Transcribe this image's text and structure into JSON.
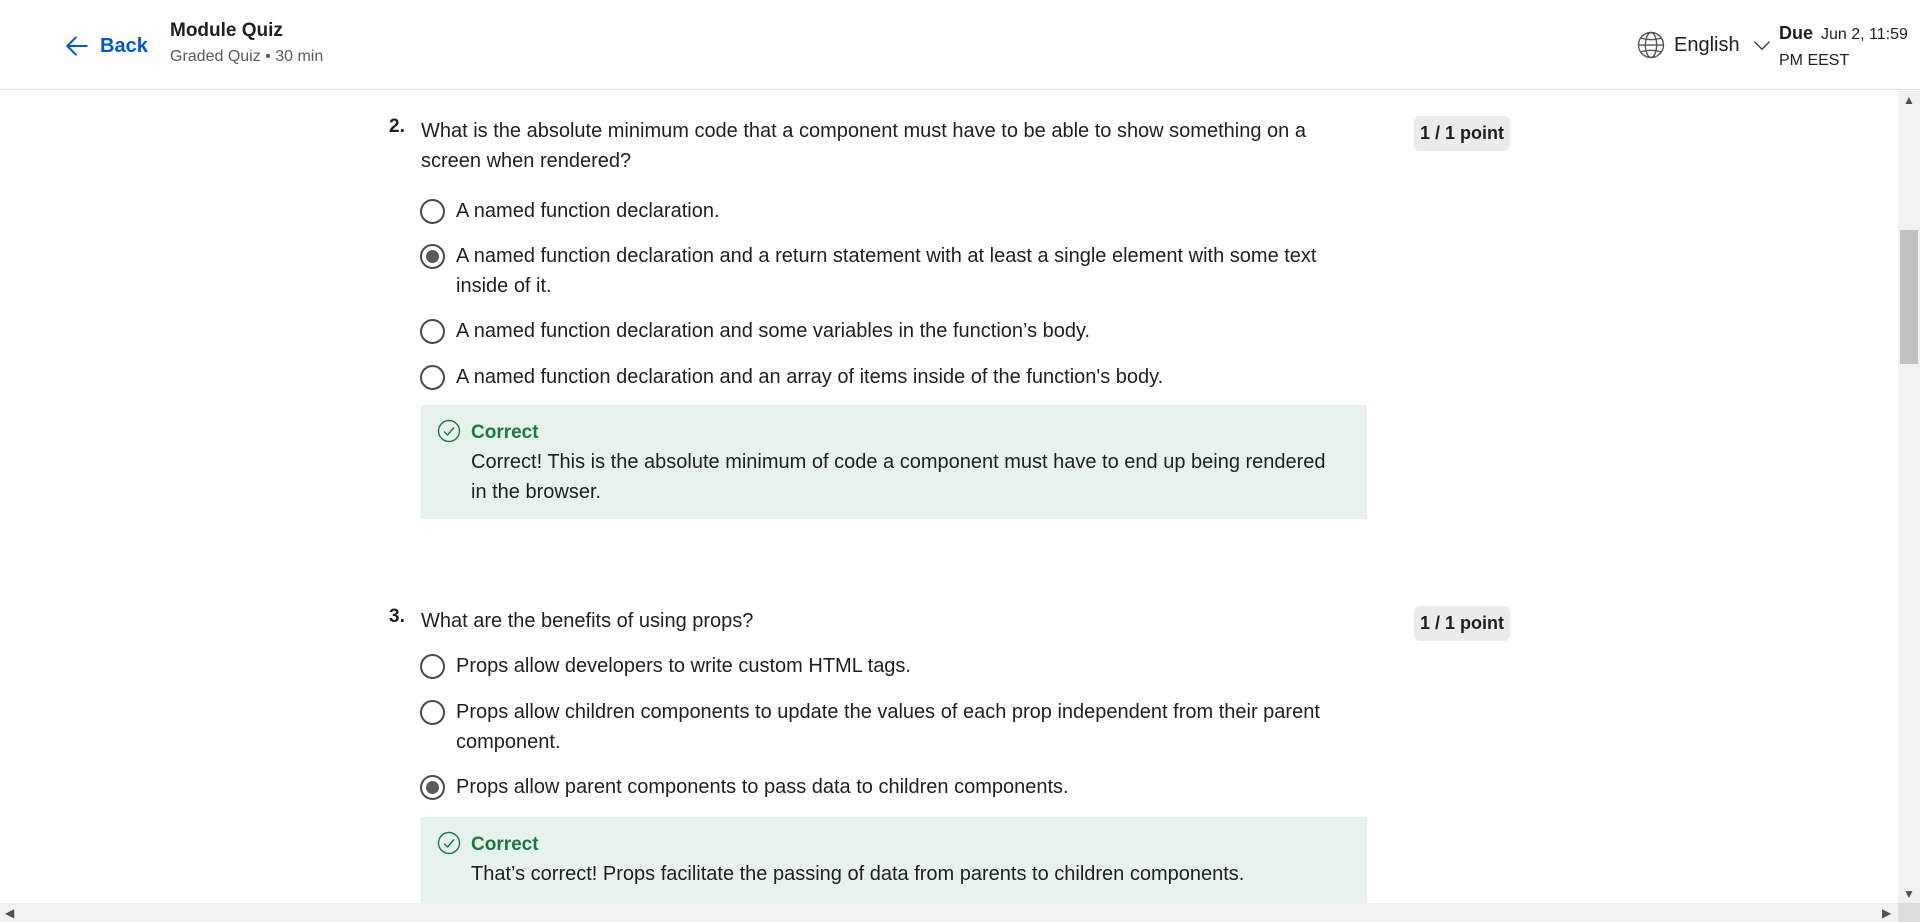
{
  "header": {
    "back_label": "Back",
    "title": "Module Quiz",
    "subtitle": "Graded Quiz • 30 min",
    "language": "English",
    "due_label": "Due",
    "due_date": "Jun 2, 11:59 PM EEST"
  },
  "questions": [
    {
      "number": "2.",
      "text": "What is the absolute minimum code that a component must have to be able to show something on a screen when rendered?",
      "points": "1 / 1 point",
      "options": [
        {
          "label": "A named function declaration.",
          "selected": false
        },
        {
          "label": "A named function declaration and a return statement with at least a single element with some text inside of it.",
          "selected": true
        },
        {
          "label": "A named function declaration and some variables in the function’s body.",
          "selected": false
        },
        {
          "label": "A named function declaration and an array of items inside of the function's body.",
          "selected": false
        }
      ],
      "feedback": {
        "title": "Correct",
        "text": "Correct! This is the absolute minimum of code a component must have to end up being rendered in the browser."
      }
    },
    {
      "number": "3.",
      "text": "What are the benefits of using props?",
      "points": "1 / 1 point",
      "options": [
        {
          "label": "Props allow developers to write custom HTML tags.",
          "selected": false
        },
        {
          "label": "Props allow children components to update the values of each prop independent from their parent component.",
          "selected": false
        },
        {
          "label": "Props allow parent components to pass data to children components.",
          "selected": true
        }
      ],
      "feedback": {
        "title": "Correct",
        "text": "That’s correct! Props facilitate the passing of data from parents to children components."
      }
    }
  ],
  "colors": {
    "accent": "#0056d2",
    "correct_green": "#1b7a3e",
    "feedback_bg": "#e7f2ee",
    "points_bg": "#ebebeb"
  }
}
